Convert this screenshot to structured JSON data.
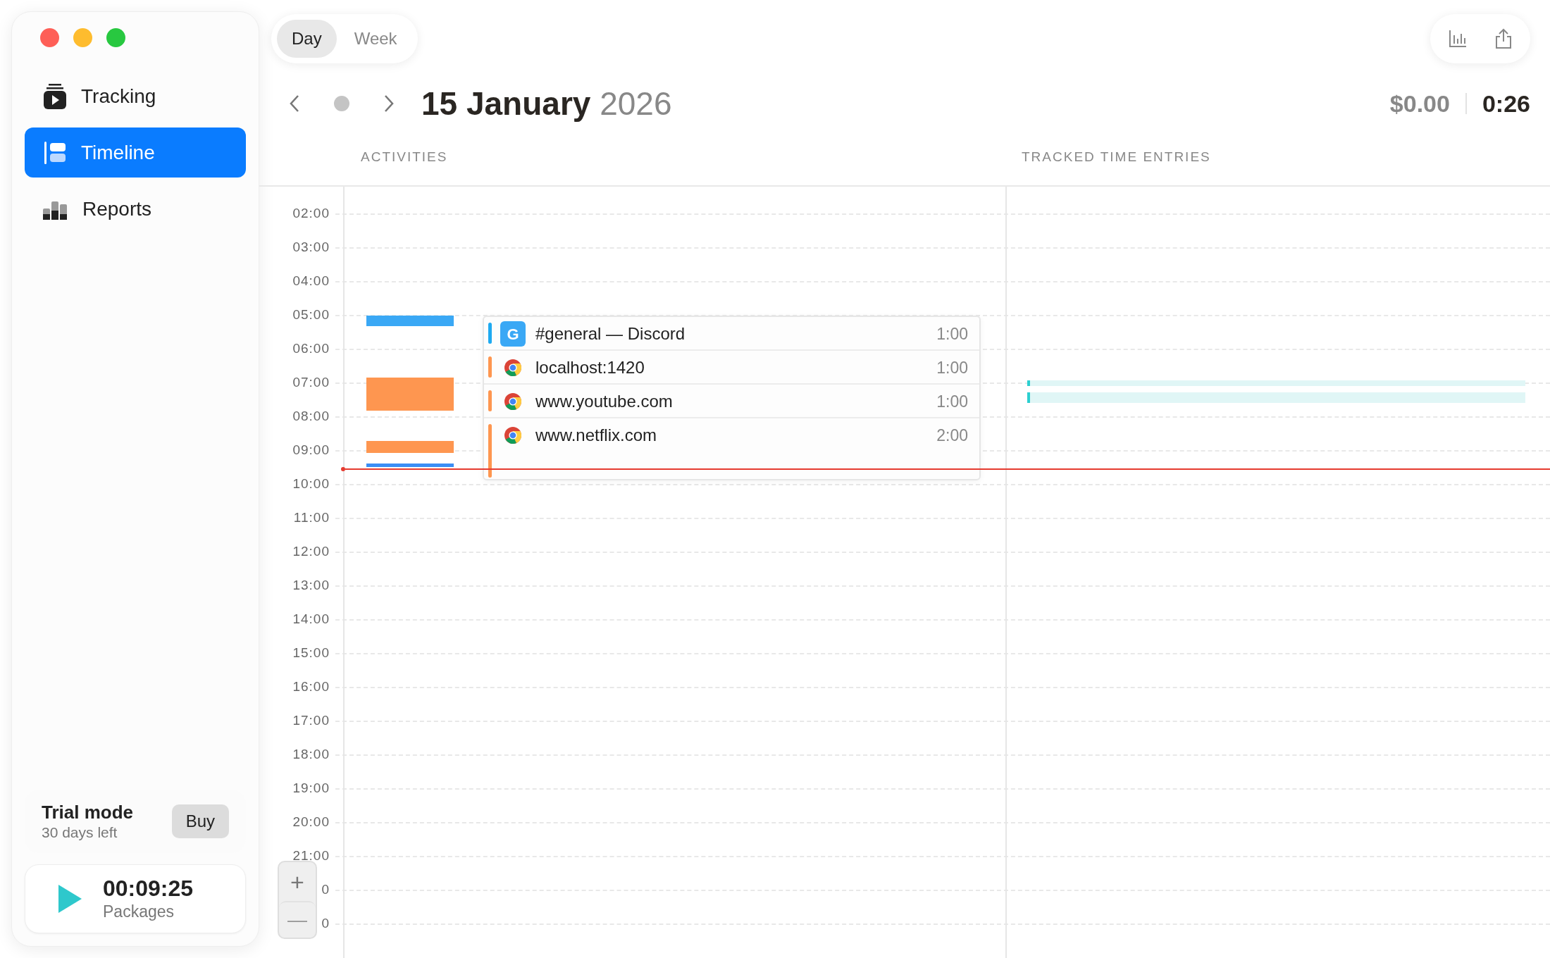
{
  "sidebar": {
    "items": [
      {
        "label": "Tracking",
        "kind": "tracking",
        "selected": false
      },
      {
        "label": "Timeline",
        "kind": "timeline",
        "selected": true
      },
      {
        "label": "Reports",
        "kind": "reports",
        "selected": false
      }
    ],
    "trial": {
      "title": "Trial mode",
      "subtitle": "30 days left",
      "button": "Buy"
    },
    "timer": {
      "time": "00:09:25",
      "project": "Packages",
      "running": false
    }
  },
  "view_tabs": [
    {
      "label": "Day",
      "selected": true
    },
    {
      "label": "Week",
      "selected": false
    }
  ],
  "date": {
    "day_month": "15 January",
    "year": "2026"
  },
  "totals": {
    "amount": "$0.00",
    "duration": "0:26"
  },
  "columns": [
    "ACTIVITIES",
    "TRACKED TIME ENTRIES"
  ],
  "hours": [
    "02:00",
    "03:00",
    "04:00",
    "05:00",
    "06:00",
    "07:00",
    "08:00",
    "09:00",
    "10:00",
    "11:00",
    "12:00",
    "13:00",
    "14:00",
    "15:00",
    "16:00",
    "17:00",
    "18:00",
    "19:00",
    "20:00",
    "21:00",
    "0",
    "0"
  ],
  "activity_bars": [
    {
      "color": "#3aa8f5"
    },
    {
      "color": "#fe9650"
    },
    {
      "color": "#fe9650"
    },
    {
      "color": "#3a8ef5"
    }
  ],
  "activity_popup": [
    {
      "name": "#general — Discord",
      "duration": "1:00",
      "kind": "app",
      "icon_letter": "G",
      "color": "#1eaaf1"
    },
    {
      "name": "localhost:1420",
      "duration": "1:00",
      "kind": "browser",
      "color": "#fe9650"
    },
    {
      "name": "www.youtube.com",
      "duration": "1:00",
      "kind": "browser",
      "color": "#fe9650"
    },
    {
      "name": "www.netflix.com",
      "duration": "2:00",
      "kind": "browser",
      "color": "#fe9650"
    }
  ],
  "zoom_controls": [
    "+",
    "—"
  ]
}
